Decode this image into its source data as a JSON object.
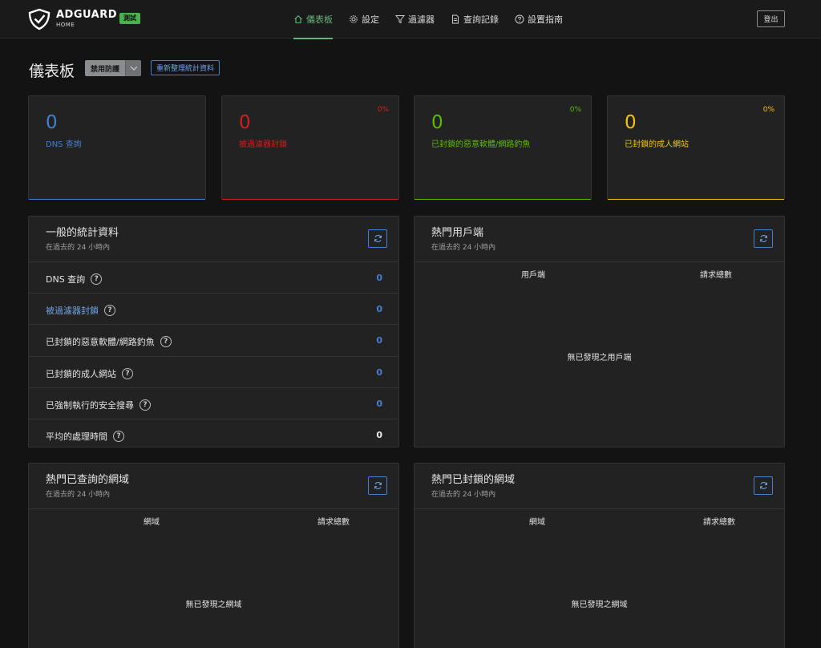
{
  "header": {
    "brand": "ADGUARD",
    "brand_sub": "HOME",
    "beta": "測試",
    "nav": [
      {
        "label": "儀表板",
        "icon": "home-icon"
      },
      {
        "label": "設定",
        "icon": "gear-icon"
      },
      {
        "label": "過濾器",
        "icon": "filter-icon"
      },
      {
        "label": "查詢記錄",
        "icon": "document-icon"
      },
      {
        "label": "設置指南",
        "icon": "help-icon"
      }
    ],
    "logout": "登出"
  },
  "page": {
    "title": "儀表板",
    "disable_protection": "禁用防護",
    "refresh_stats": "重新整理統計資料"
  },
  "stats": [
    {
      "value": "0",
      "label": "DNS 查詢",
      "percent": "",
      "color": "#467fcf"
    },
    {
      "value": "0",
      "label": "被過濾器封鎖",
      "percent": "0%",
      "color": "#cd201f"
    },
    {
      "value": "0",
      "label": "已封鎖的惡意軟體/網路釣魚",
      "percent": "0%",
      "color": "#5eba00"
    },
    {
      "value": "0",
      "label": "已封鎖的成人網站",
      "percent": "0%",
      "color": "#f1c40f"
    }
  ],
  "general": {
    "title": "一般的統計資料",
    "subtitle": "在過去的 24 小時內",
    "rows": [
      {
        "label": "DNS 查詢",
        "value": "0"
      },
      {
        "label": "被過濾器封鎖",
        "value": "0"
      },
      {
        "label": "已封鎖的惡意軟體/網路釣魚",
        "value": "0"
      },
      {
        "label": "已封鎖的成人網站",
        "value": "0"
      },
      {
        "label": "已強制執行的安全搜尋",
        "value": "0"
      },
      {
        "label": "平均的處理時間",
        "value": "0"
      }
    ]
  },
  "top_clients": {
    "title": "熱門用戶端",
    "subtitle": "在過去的 24 小時內",
    "col1": "用戶端",
    "col2": "請求總數",
    "empty": "無已發現之用戶端"
  },
  "top_queried": {
    "title": "熱門已查詢的網域",
    "subtitle": "在過去的 24 小時內",
    "col1": "網域",
    "col2": "請求總數",
    "empty": "無已發現之網域"
  },
  "top_blocked": {
    "title": "熱門已封鎖的網域",
    "subtitle": "在過去的 24 小時內",
    "col1": "網域",
    "col2": "請求總數",
    "empty": "無已發現之網域"
  }
}
